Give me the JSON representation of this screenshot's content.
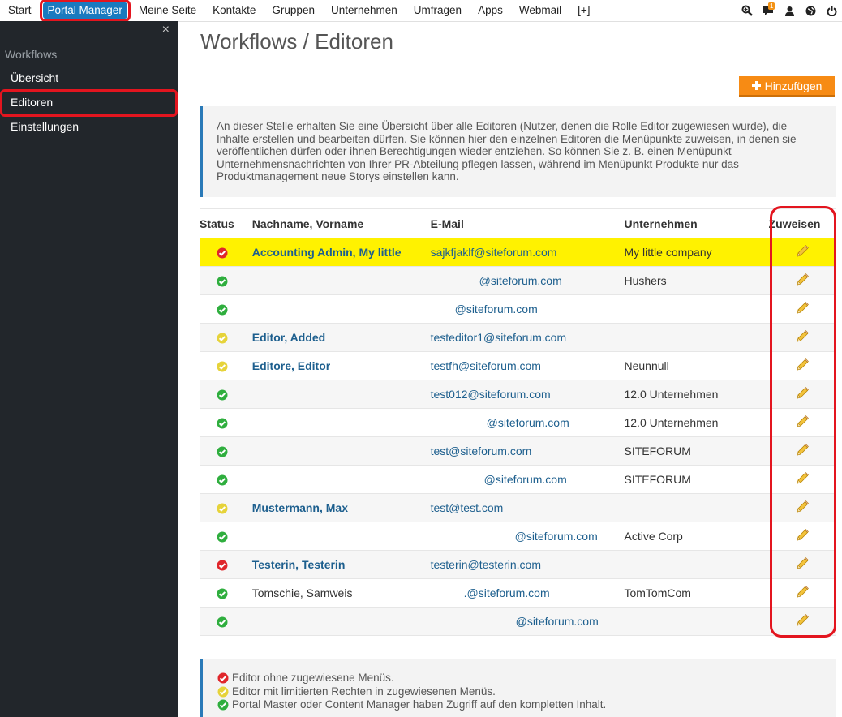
{
  "topnav": {
    "items": [
      "Start",
      "Portal Manager",
      "Meine Seite",
      "Kontakte",
      "Gruppen",
      "Unternehmen",
      "Umfragen",
      "Apps",
      "Webmail",
      "[+]"
    ],
    "active_index": 1,
    "notification_count": "1",
    "icons": [
      "zoom-icon",
      "chat-bubble-icon",
      "user-icon",
      "globe-icon",
      "power-icon"
    ]
  },
  "sidebar": {
    "close_glyph": "×",
    "header": "Workflows",
    "items": [
      "Übersicht",
      "Editoren",
      "Einstellungen"
    ],
    "active_index": 1
  },
  "page": {
    "title": "Workflows / Editoren",
    "add_button": "Hinzufügen",
    "info_text": "An dieser Stelle erhalten Sie eine Übersicht über alle Editoren (Nutzer, denen die Rolle Editor zugewiesen wurde), die Inhalte erstellen und bearbeiten dürfen. Sie können hier den einzelnen Editoren die Menüpunkte zuweisen, in denen sie veröffentlichen dürfen oder ihnen Berechtigungen wieder entziehen. So können Sie z. B. einen Menüpunkt Unternehmensnachrichten von Ihrer PR-Abteilung pflegen lassen, während im Menüpunkt Produkte nur das Produktmanagement neue Storys einstellen kann."
  },
  "table": {
    "headers": [
      "Status",
      "Nachname, Vorname",
      "E-Mail",
      "Unternehmen",
      "Zuweisen"
    ],
    "rows": [
      {
        "status": "red",
        "name": "Accounting Admin, My little",
        "name_style": "link",
        "email": "sajkfjaklf@siteforum.com",
        "email_indent": 0,
        "company": "My little company",
        "highlight": true
      },
      {
        "status": "green",
        "name": "",
        "name_style": "link",
        "email": "@siteforum.com",
        "email_indent": 60,
        "company": "Hushers",
        "highlight": false
      },
      {
        "status": "green",
        "name": "",
        "name_style": "link",
        "email": "@siteforum.com",
        "email_indent": 30,
        "company": "",
        "highlight": false
      },
      {
        "status": "yellow",
        "name": "Editor, Added",
        "name_style": "link",
        "email": "testeditor1@siteforum.com",
        "email_indent": 0,
        "company": "",
        "highlight": false
      },
      {
        "status": "yellow",
        "name": "Editore, Editor",
        "name_style": "link",
        "email": "testfh@siteforum.com",
        "email_indent": 0,
        "company": "Neunnull",
        "highlight": false
      },
      {
        "status": "green",
        "name": "",
        "name_style": "link",
        "email": "test012@siteforum.com",
        "email_indent": 0,
        "company": "12.0 Unternehmen",
        "highlight": false
      },
      {
        "status": "green",
        "name": "",
        "name_style": "link",
        "email": "@siteforum.com",
        "email_indent": 69,
        "company": "12.0 Unternehmen",
        "highlight": false
      },
      {
        "status": "green",
        "name": "",
        "name_style": "link",
        "email": "test@siteforum.com",
        "email_indent": 0,
        "company": "SITEFORUM",
        "highlight": false
      },
      {
        "status": "green",
        "name": "",
        "name_style": "link",
        "email": "@siteforum.com",
        "email_indent": 66,
        "company": "SITEFORUM",
        "highlight": false
      },
      {
        "status": "yellow",
        "name": "Mustermann, Max",
        "name_style": "link",
        "email": "test@test.com",
        "email_indent": 0,
        "company": "",
        "highlight": false
      },
      {
        "status": "green",
        "name": "",
        "name_style": "link",
        "email": "@siteforum.com",
        "email_indent": 104,
        "company": "Active Corp",
        "highlight": false
      },
      {
        "status": "red",
        "name": "Testerin, Testerin",
        "name_style": "link",
        "email": "testerin@testerin.com",
        "email_indent": 0,
        "company": "",
        "highlight": false
      },
      {
        "status": "green",
        "name": "Tomschie, Samweis",
        "name_style": "plain",
        "email": ".@siteforum.com",
        "email_indent": 41,
        "company": "TomTomCom",
        "highlight": false
      },
      {
        "status": "green",
        "name": "",
        "name_style": "link",
        "email": "@siteforum.com",
        "email_indent": 105,
        "company": "",
        "highlight": false
      }
    ]
  },
  "legend": [
    {
      "status": "red",
      "text": "Editor ohne zugewiesene Menüs."
    },
    {
      "status": "yellow",
      "text": "Editor mit limitierten Rechten in zugewiesenen Menüs."
    },
    {
      "status": "green",
      "text": "Portal Master oder Content Manager haben Zugriff auf den kompletten Inhalt."
    }
  ],
  "colors": {
    "red": "#e0262b",
    "yellow": "#e6d33a",
    "green": "#2fae3e",
    "accent": "#1a7abf",
    "add_button": "#f78b14",
    "highlight_row": "#fff200"
  }
}
